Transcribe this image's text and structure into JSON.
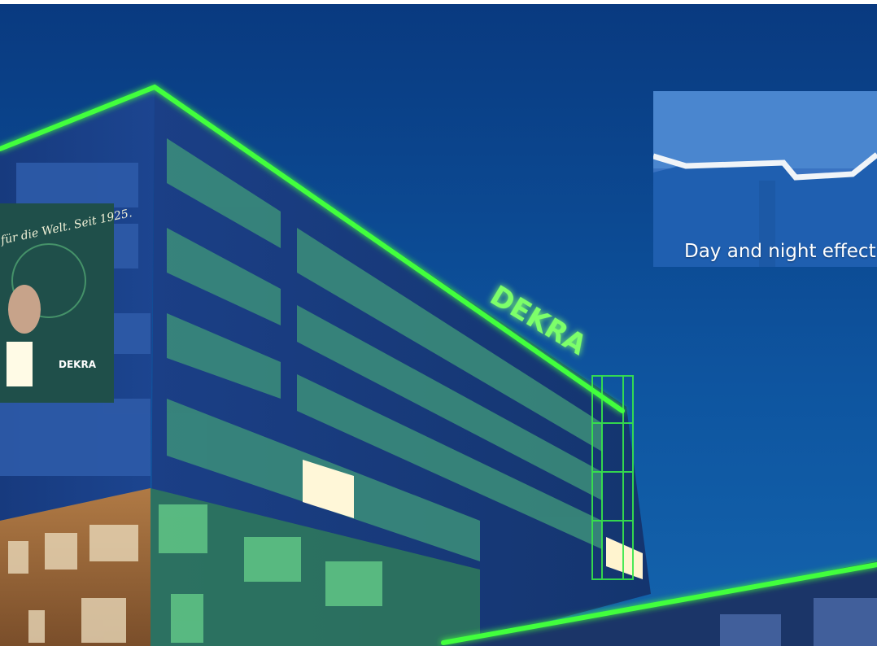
{
  "photo": {
    "subject": "office-building-night-photo",
    "sign_text": "DEKRA",
    "banner_text": "für die Welt. Seit 1925.",
    "banner_logo": "DEKRA"
  },
  "inset": {
    "caption": "Day and night effect"
  },
  "colors": {
    "sky_top": "#0b3f86",
    "sky_bottom": "#0f5aa3",
    "neon_green": "#3dff3a",
    "facade_blue": "#1a3f8a"
  }
}
